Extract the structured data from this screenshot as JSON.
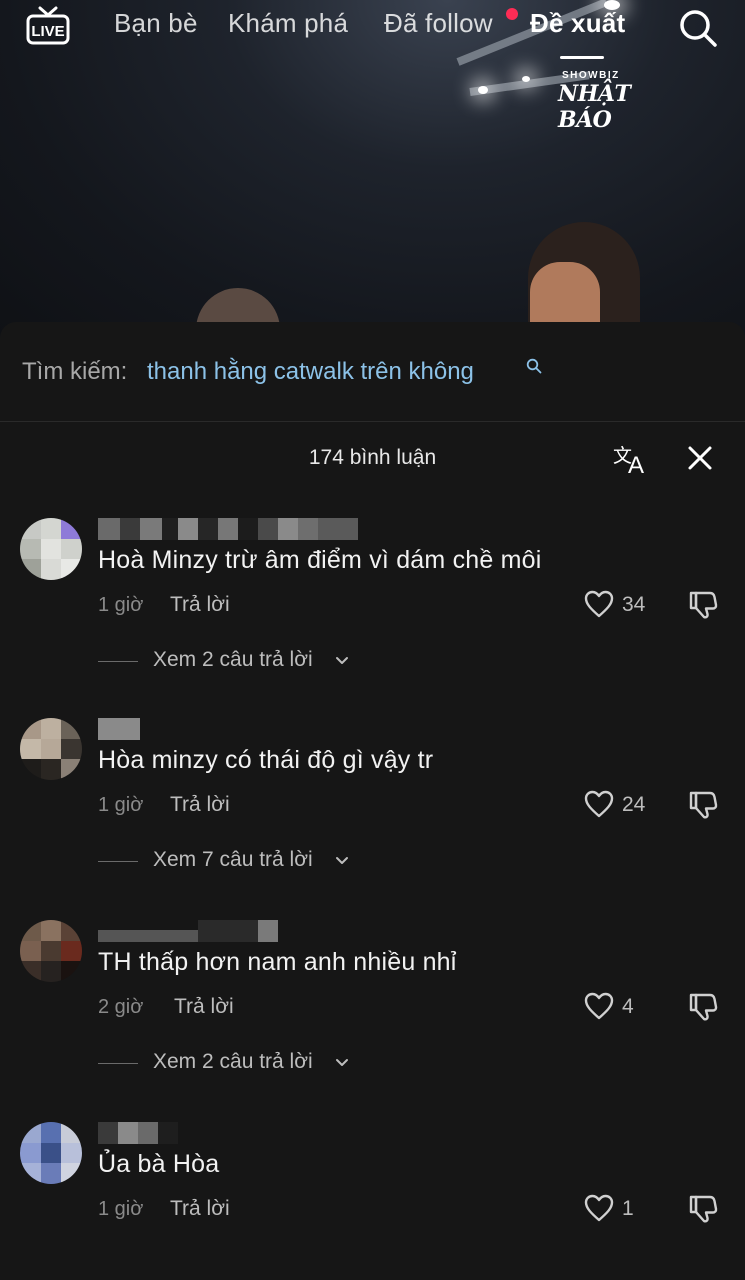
{
  "nav": {
    "live_label": "LIVE",
    "tabs": [
      {
        "label": "Bạn bè"
      },
      {
        "label": "Khám phá"
      },
      {
        "label": "Đã follow"
      },
      {
        "label": "Đề xuất"
      }
    ],
    "active_tab": "Đề xuất"
  },
  "watermark": {
    "line1": "SHOWBIZ",
    "line2": "NHẬT BÁO"
  },
  "search": {
    "prefix": "Tìm kiếm:",
    "query": "thanh hằng catwalk trên không"
  },
  "sheet": {
    "comment_count": "174 bình luận"
  },
  "comments": [
    {
      "username_partial": "",
      "text": "Hoà Minzy trừ âm điểm vì dám chề môi",
      "time": "1 giờ",
      "reply_label": "Trả lời",
      "likes": "34",
      "view_replies": "Xem 2 câu trả lời"
    },
    {
      "username_partial": "h",
      "text": "Hòa minzy có thái độ gì vậy tr",
      "time": "1 giờ",
      "reply_label": "Trả lời",
      "likes": "24",
      "view_replies": "Xem 7 câu trả lời"
    },
    {
      "username_partial": "Dongthieng",
      "text": "TH thấp hơn nam anh nhiều nhỉ",
      "time": "2 giờ",
      "reply_label": "Trả lời",
      "likes": "4",
      "view_replies": "Xem 2 câu trả lời"
    },
    {
      "username_partial": "",
      "text": "Ủa bà Hòa",
      "time": "1 giờ",
      "reply_label": "Trả lời",
      "likes": "1",
      "view_replies": ""
    }
  ],
  "colors": {
    "accent_red": "#fe2c55",
    "search_link": "#8cc2e8",
    "sheet_bg": "#161616"
  }
}
